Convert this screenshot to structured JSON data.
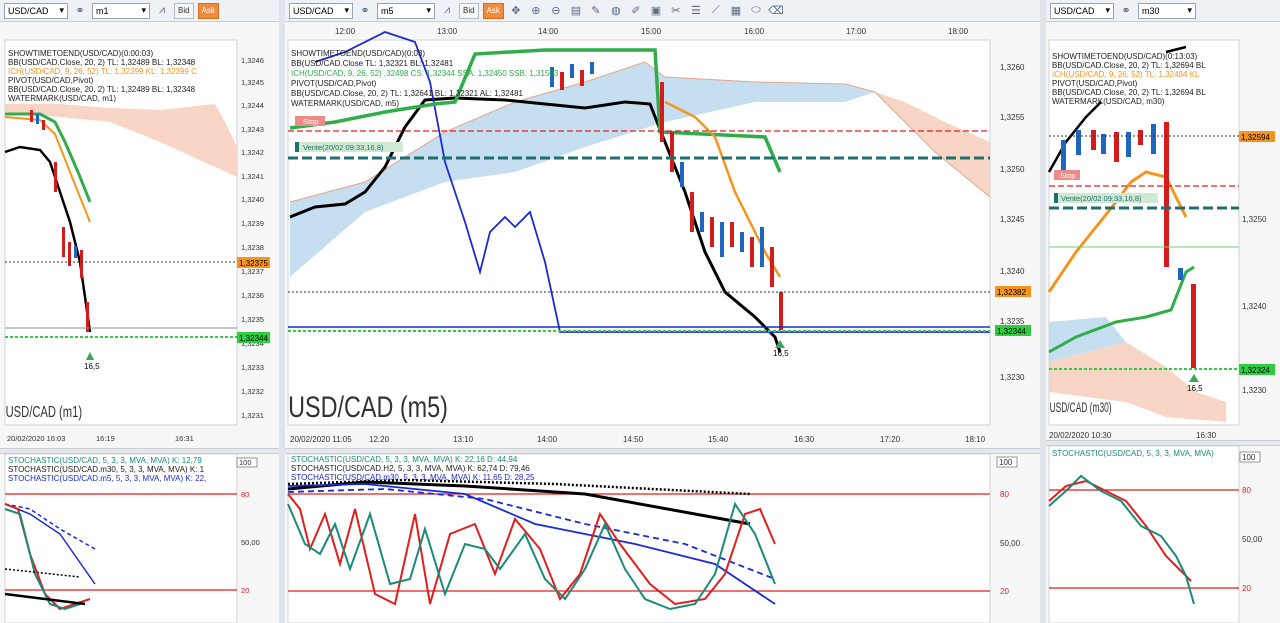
{
  "panels": [
    {
      "id": "m1",
      "symbol": "USD/CAD",
      "timeframe": "m1",
      "bid": "Bid",
      "ask": "Ask",
      "watermark": "USD/CAD (m1)",
      "indicator_text": [
        "SHOWTIMETOEND(USD/CAD)(0:00:03)",
        "BB(USD/CAD.Close, 20, 2)  TL: 1,32489  BL: 1,32348",
        "ICH(USD/CAD, 9, 26, 52)  TL: 1,32399  KL: 1,32399  C",
        "PIVOT(USD/CAD,Pivot)",
        "BB(USD/CAD.Close, 20, 2)  TL: 1,32489  BL: 1,32348",
        "WATERMARK(USD/CAD, m1)"
      ],
      "price_ticks": [
        "1,3246",
        "1,3245",
        "1,3244",
        "1,3243",
        "1,3242",
        "1,3241",
        "1,3240",
        "1,3239",
        "1,3238",
        "1,3237",
        "1,3236",
        "1,3235",
        "1,3234",
        "1,3233",
        "1,3232",
        "1,3231"
      ],
      "time_ticks": [
        "20/02/2020 16:03",
        "16:19",
        "16:31"
      ],
      "badges": [
        {
          "text": "1,32375",
          "color": "#f7941d"
        },
        {
          "text": "1,32344",
          "color": "#2ecc40"
        }
      ],
      "arrow_label": "16,5",
      "stoch_text": [
        "STOCHASTIC(USD/CAD, 5, 3, 3, MVA, MVA)  K: 12,79",
        "STOCHASTIC(USD/CAD.m30, 5, 3, 3, MVA, MVA)  K: 1",
        "STOCHASTIC(USD/CAD.m5, 5, 3, 3, MVA, MVA)  K: 22,"
      ],
      "stoch_ticks": [
        "100",
        "80",
        "50,00",
        "20"
      ]
    },
    {
      "id": "m5",
      "symbol": "USD/CAD",
      "timeframe": "m5",
      "bid": "Bid",
      "ask": "Ask",
      "watermark": "USD/CAD (m5)",
      "indicator_text": [
        "SHOWTIMETOEND(USD/CAD)(0:03)",
        "BB(USD/CAD.Close  TL: 1,32321  BL: 1,32481",
        "ICH(USD/CAD, 9, 26, 52)  ,32498  CS: 1,32344  SSA: 1,32450  SSB: 1,31503",
        "PIVOT(USD/CAD,Pivot)",
        "BB(USD/CAD.Close, 20, 2)  TL: 1,32641  BL: 1,32321  AL: 1,32481",
        "WATERMARK(USD/CAD, m5)"
      ],
      "top_times": [
        "12:00",
        "13:00",
        "14:00",
        "15:00",
        "16:00",
        "17:00",
        "18:00"
      ],
      "price_ticks": [
        "1,3260",
        "1,3255",
        "1,3250",
        "1,3245",
        "1,3240",
        "1,3235",
        "1,3230"
      ],
      "time_ticks": [
        "20/02/2020 11:05",
        "12:20",
        "13:10",
        "14:00",
        "14:50",
        "15:40",
        "16:30",
        "17:20",
        "18:10"
      ],
      "badges": [
        {
          "text": "1,32382",
          "color": "#f7941d"
        },
        {
          "text": "1,32344",
          "color": "#2ecc40"
        }
      ],
      "stop_label": "Stop",
      "vente_label": "Vente(20/02 09:33,16,8)",
      "arrow_label": "16,5",
      "stoch_text": [
        "STOCHASTIC(USD/CAD, 5, 3, 3, MVA, MVA)  K: 22,16  D: 44,94",
        "STOCHASTIC(USD/CAD.H2, 5, 3, 3, MVA, MVA)  K: 62,74  D: 79,46",
        "STOCHASTIC(USD/CAD.m30, 5, 3, 3, MVA, MVA)  K: 11,65  D: 28,25"
      ],
      "stoch_ticks": [
        "100",
        "80",
        "50,00",
        "20"
      ]
    },
    {
      "id": "m30",
      "symbol": "USD/CAD",
      "timeframe": "m30",
      "watermark": "USD/CAD (m30)",
      "indicator_text": [
        "SHOWTIMETOEND(USD/CAD)(0:13:03)",
        "BB(USD/CAD.Close, 20, 2)  TL: 1,32694  BL",
        "ICH(USD/CAD, 9, 26, 52)  TL: 1,32484  KL",
        "PIVOT(USD/CAD,Pivot)",
        "BB(USD/CAD.Close, 20, 2)  TL: 1,32694  BL",
        "WATERMARK(USD/CAD, m30)"
      ],
      "price_ticks": [
        "1,3250",
        "1,3240",
        "1,3230"
      ],
      "time_ticks": [
        "20/02/2020 10:30",
        "16:30"
      ],
      "badges": [
        {
          "text": "1,32594",
          "color": "#f7941d"
        },
        {
          "text": "1,32324",
          "color": "#2ecc40"
        }
      ],
      "stop_label": "Stop",
      "vente_label": "Vente(20/02 09:33,16,8)",
      "arrow_label": "16,5",
      "stoch_text": [
        "STOCHASTIC(USD/CAD, 5, 3, 3, MVA, MVA)"
      ],
      "stoch_ticks": [
        "100",
        "80",
        "50,00",
        "20"
      ]
    }
  ],
  "colors": {
    "bull": "#1f66c2",
    "bear": "#d51c1c",
    "kumo_bull": "#b8d7ec",
    "kumo_bear": "#f6cbb7",
    "kijun": "#2ead4a",
    "tenkan": "#f7941d",
    "bb": "#000000",
    "chikou": "#1a2bd6",
    "pivot": "#1f6f6f",
    "stoch_k": "#e31d1d",
    "stoch_d": "#1a8a7a"
  }
}
